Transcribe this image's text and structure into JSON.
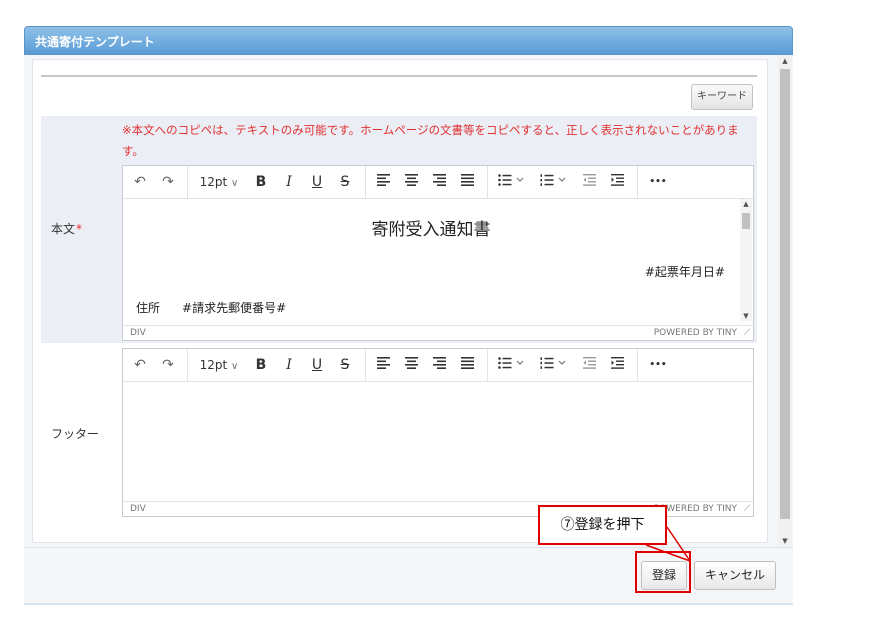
{
  "dialog": {
    "title": "共通寄付テンプレート"
  },
  "keyword_button": "キーワード",
  "body_field": {
    "label": "本文",
    "required_mark": "*",
    "notice": "※本文へのコピペは、テキストのみ可能です。ホームページの文書等をコピペすると、正しく表示されないことがあります。",
    "content": {
      "title": "寄附受入通知書",
      "date_placeholder": "#起票年月日#",
      "address_label": "住所",
      "postal_placeholder": "#請求先郵便番号#"
    },
    "status_path": "DIV",
    "powered_by": "POWERED BY TINY"
  },
  "footer_field": {
    "label": "フッター",
    "status_path": "DIV",
    "powered_by": "POWERED BY TINY"
  },
  "toolbar": {
    "undo": "↶",
    "redo": "↷",
    "font_size": "12pt",
    "font_size_arrow": "∨",
    "bold": "B",
    "italic": "I",
    "underline": "U",
    "strike": "S",
    "more": "•••"
  },
  "buttons": {
    "register": "登録",
    "cancel": "キャンセル"
  },
  "annotation": {
    "callout_text": "⑦登録を押下",
    "color": "#e00000"
  },
  "colors": {
    "title_bar": "#5a9bd4",
    "notice_text": "#e03030"
  }
}
